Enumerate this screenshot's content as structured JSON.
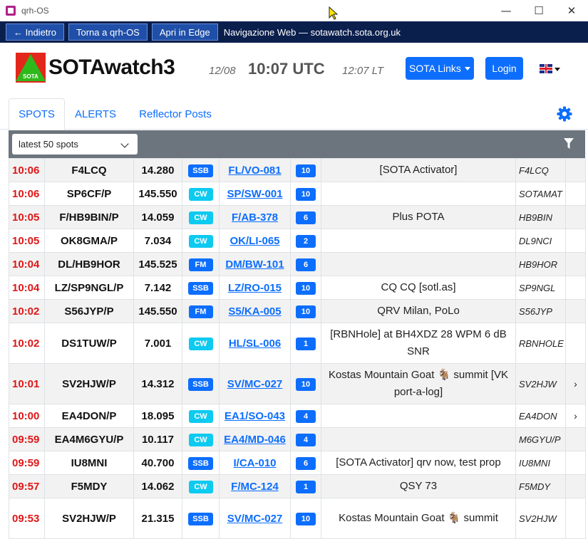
{
  "window": {
    "title": "qrh-OS",
    "minimize": "—",
    "maximize": "☐",
    "close": "✕"
  },
  "nav": {
    "back": "← Indietro",
    "home": "Torna a qrh-OS",
    "edge": "Apri in Edge",
    "title": "Navigazione Web — sotawatch.sota.org.uk"
  },
  "header": {
    "logo_text": "SOTA",
    "brand": "SOTAwatch3",
    "date": "12/08",
    "utc": "10:07 UTC",
    "local": "12:07 LT",
    "sota_links": "SOTA Links",
    "login": "Login"
  },
  "tabs": [
    {
      "label": "SPOTS"
    },
    {
      "label": "ALERTS"
    },
    {
      "label": "Reflector Posts"
    }
  ],
  "filter": {
    "selected": "latest 50 spots"
  },
  "spots": [
    {
      "time": "10:06",
      "call": "F4LCQ",
      "freq": "14.280",
      "mode": "SSB",
      "summit": "FL/VO-081",
      "pts": "10",
      "comment": "[SOTA Activator]",
      "by": "F4LCQ",
      "arrow": ""
    },
    {
      "time": "10:06",
      "call": "SP6CF/P",
      "freq": "145.550",
      "mode": "CW",
      "summit": "SP/SW-001",
      "pts": "10",
      "comment": "",
      "by": "SOTAMAT",
      "arrow": ""
    },
    {
      "time": "10:05",
      "call": "F/HB9BIN/P",
      "freq": "14.059",
      "mode": "CW",
      "summit": "F/AB-378",
      "pts": "6",
      "comment": "Plus POTA",
      "by": "HB9BIN",
      "arrow": ""
    },
    {
      "time": "10:05",
      "call": "OK8GMA/P",
      "freq": "7.034",
      "mode": "CW",
      "summit": "OK/LI-065",
      "pts": "2",
      "comment": "",
      "by": "DL9NCI",
      "arrow": ""
    },
    {
      "time": "10:04",
      "call": "DL/HB9HOR",
      "freq": "145.525",
      "mode": "FM",
      "summit": "DM/BW-101",
      "pts": "6",
      "comment": "",
      "by": "HB9HOR",
      "arrow": ""
    },
    {
      "time": "10:04",
      "call": "LZ/SP9NGL/P",
      "freq": "7.142",
      "mode": "SSB",
      "summit": "LZ/RO-015",
      "pts": "10",
      "comment": "CQ CQ [sotl.as]",
      "by": "SP9NGL",
      "arrow": ""
    },
    {
      "time": "10:02",
      "call": "S56JYP/P",
      "freq": "145.550",
      "mode": "FM",
      "summit": "S5/KA-005",
      "pts": "10",
      "comment": "QRV Milan, PoLo",
      "by": "S56JYP",
      "arrow": ""
    },
    {
      "time": "10:02",
      "call": "DS1TUW/P",
      "freq": "7.001",
      "mode": "CW",
      "summit": "HL/SL-006",
      "pts": "1",
      "comment": "[RBNHole] at BH4XDZ 28 WPM 6 dB SNR",
      "by": "RBNHOLE",
      "arrow": ""
    },
    {
      "time": "10:01",
      "call": "SV2HJW/P",
      "freq": "14.312",
      "mode": "SSB",
      "summit": "SV/MC-027",
      "pts": "10",
      "comment": "Kostas Mountain Goat 🐐 summit [VK port-a-log]",
      "by": "SV2HJW",
      "arrow": "›"
    },
    {
      "time": "10:00",
      "call": "EA4DON/P",
      "freq": "18.095",
      "mode": "CW",
      "summit": "EA1/SO-043",
      "pts": "4",
      "comment": "",
      "by": "EA4DON",
      "arrow": "›"
    },
    {
      "time": "09:59",
      "call": "EA4M6GYU/P",
      "freq": "10.117",
      "mode": "CW",
      "summit": "EA4/MD-046",
      "pts": "4",
      "comment": "",
      "by": "M6GYU/P",
      "arrow": ""
    },
    {
      "time": "09:59",
      "call": "IU8MNI",
      "freq": "40.700",
      "mode": "SSB",
      "summit": "I/CA-010",
      "pts": "6",
      "comment": "[SOTA Activator] qrv now, test prop",
      "by": "IU8MNI",
      "arrow": ""
    },
    {
      "time": "09:57",
      "call": "F5MDY",
      "freq": "14.062",
      "mode": "CW",
      "summit": "F/MC-124",
      "pts": "1",
      "comment": "QSY 73",
      "by": "F5MDY",
      "arrow": ""
    },
    {
      "time": "09:53",
      "call": "SV2HJW/P",
      "freq": "21.315",
      "mode": "SSB",
      "summit": "SV/MC-027",
      "pts": "10",
      "comment": "Kostas Mountain Goat 🐐 summit",
      "by": "SV2HJW",
      "arrow": ""
    }
  ]
}
